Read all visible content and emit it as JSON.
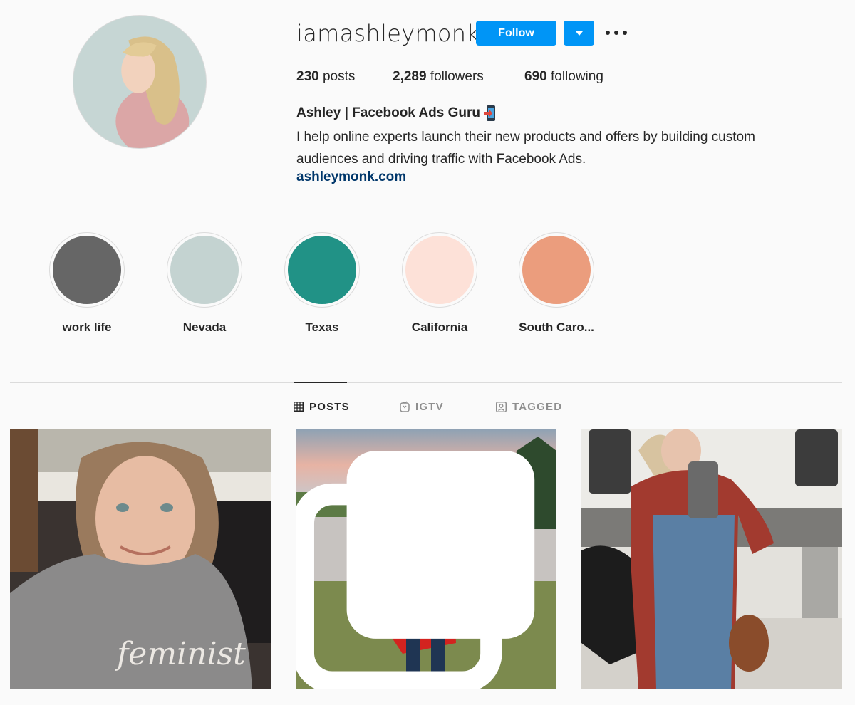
{
  "profile": {
    "username": "iamashleymonk",
    "follow_label": "Follow",
    "stats": {
      "posts_count": "230",
      "posts_label": "posts",
      "followers_count": "2,289",
      "followers_label": "followers",
      "following_count": "690",
      "following_label": "following"
    },
    "full_name": "Ashley | Facebook Ads Guru",
    "bio": "I help online experts launch their new products and offers by building custom audiences and driving traffic with Facebook Ads.",
    "website": "ashleymonk.com"
  },
  "highlights": [
    {
      "label": "work life",
      "color": "#666666"
    },
    {
      "label": "Nevada",
      "color": "#c4d3d1"
    },
    {
      "label": "Texas",
      "color": "#219286"
    },
    {
      "label": "California",
      "color": "#fde1d8"
    },
    {
      "label": "South Caro...",
      "color": "#eb9d7d"
    }
  ],
  "tabs": [
    {
      "label": "POSTS",
      "icon": "grid-icon",
      "active": true
    },
    {
      "label": "IGTV",
      "icon": "igtv-icon",
      "active": false
    },
    {
      "label": "TAGGED",
      "icon": "tagged-icon",
      "active": false
    }
  ],
  "posts": [
    {
      "icon": "photo",
      "multi": false
    },
    {
      "icon": "photo",
      "multi": true
    },
    {
      "icon": "photo",
      "multi": false
    }
  ],
  "colors": {
    "accent": "#0095f6",
    "link": "#00376b",
    "text": "#262626",
    "muted": "#8e8e8e",
    "background": "#fafafa"
  }
}
